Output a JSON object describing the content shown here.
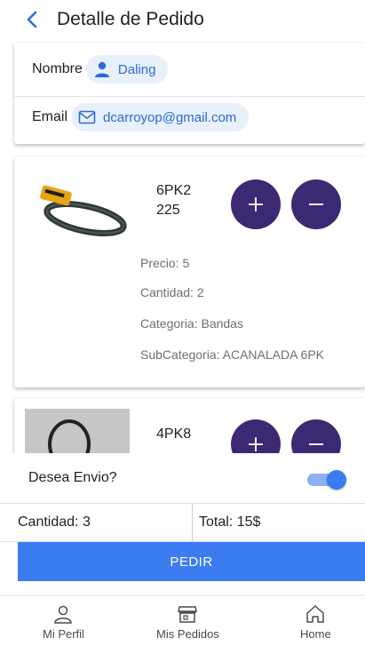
{
  "header": {
    "title": "Detalle de Pedido"
  },
  "contact": {
    "name_label": "Nombre",
    "name_value": "Daling",
    "email_label": "Email",
    "email_value": "dcarroyop@gmail.com"
  },
  "products": [
    {
      "code_line1": "6PK2",
      "code_line2": "225",
      "precio": "Precio: 5",
      "cantidad": "Cantidad: 2",
      "categoria": "Categoria: Bandas",
      "subcategoria": "SubCategoria: ACANALADA 6PK"
    },
    {
      "code_line1": "4PK8"
    }
  ],
  "shipping": {
    "label": "Desea Envio?",
    "enabled": true
  },
  "totals": {
    "quantity": "Cantidad: 3",
    "total": "Total: 15$"
  },
  "order_button": {
    "label": "PEDIR"
  },
  "tabbar": {
    "items": [
      {
        "label": "Mi Perfil",
        "icon": "person-icon"
      },
      {
        "label": "Mis Pedidos",
        "icon": "store-icon"
      },
      {
        "label": "Home",
        "icon": "home-icon"
      }
    ]
  },
  "colors": {
    "accent": "#3b7cf0",
    "qty_button": "#3b2a73",
    "chip_bg": "#e7f0fb",
    "chip_text": "#2d6bd6"
  }
}
